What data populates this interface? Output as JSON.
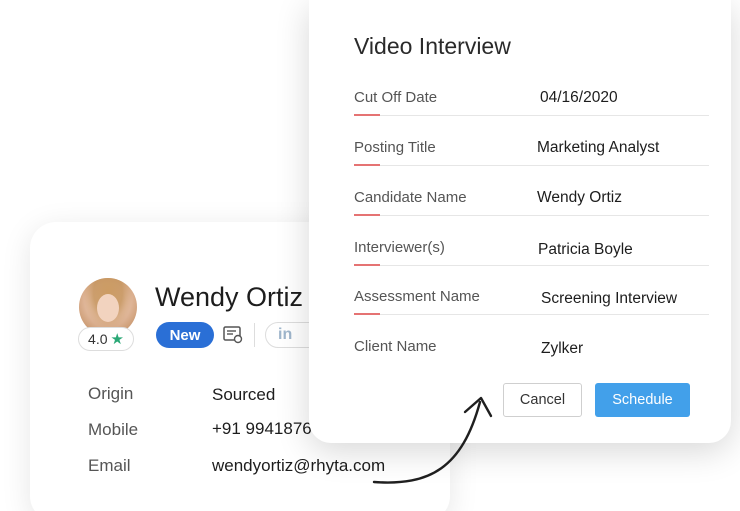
{
  "candidate": {
    "name": "Wendy Ortiz",
    "rating": "4.0",
    "rating_icon": "star-icon",
    "badge": "New",
    "linkedin_label": "in",
    "fields": [
      {
        "label": "Origin",
        "value": "Sourced"
      },
      {
        "label": "Mobile",
        "value": "+91 9941876"
      },
      {
        "label": "Email",
        "value": "wendyortiz@rhyta.com"
      }
    ]
  },
  "modal": {
    "title": "Video Interview",
    "rows": [
      {
        "label": "Cut Off Date",
        "value": "04/16/2020"
      },
      {
        "label": "Posting Title",
        "value": "Marketing Analyst"
      },
      {
        "label": "Candidate Name",
        "value": "Wendy Ortiz"
      },
      {
        "label": "Interviewer(s)",
        "value": "Patricia Boyle"
      },
      {
        "label": "Assessment Name",
        "value": "Screening Interview"
      },
      {
        "label": "Client Name",
        "value": "Zylker"
      }
    ],
    "cancel_label": "Cancel",
    "schedule_label": "Schedule"
  },
  "colors": {
    "accent_line": "#e57373",
    "primary_button": "#42a0ea",
    "badge_new": "#2a6fd6",
    "rating_star": "#2aa876"
  }
}
